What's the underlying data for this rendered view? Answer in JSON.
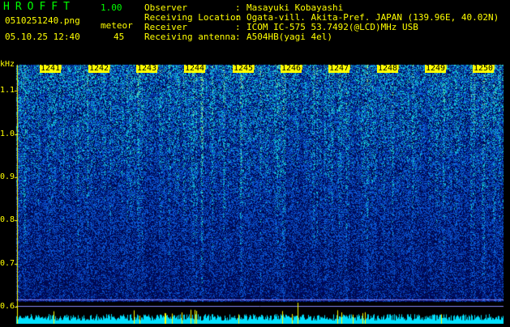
{
  "app": {
    "name": "HROFFT",
    "version": "1.00"
  },
  "capture": {
    "filename": "0510251240.png",
    "datetime": "05.10.25 12:40",
    "meteor_label": "meteor",
    "meteor_count": "45"
  },
  "info": [
    {
      "key": "Observer",
      "sep": ":",
      "value": "Masayuki Kobayashi"
    },
    {
      "key": "Receiving Location",
      "sep": ":",
      "value": "Ogata-vill. Akita-Pref. JAPAN (139.96E, 40.02N)"
    },
    {
      "key": "Receiver",
      "sep": ":",
      "value": "ICOM IC-575 53.7492(@LCD)MHz USB"
    },
    {
      "key": "Receiving antenna",
      "sep": ":",
      "value": "A504HB(yagi 4el)"
    }
  ],
  "spectrogram": {
    "y_unit": "kHz",
    "y_ticks": [
      "1.1",
      "1.0",
      "0.9",
      "0.8",
      "0.7",
      "0.6"
    ],
    "y_tick_values": [
      1.1,
      1.0,
      0.9,
      0.8,
      0.7,
      0.6
    ],
    "y_range": [
      0.58,
      1.16
    ],
    "x_ticks": [
      "1241",
      "1242",
      "1243",
      "1244",
      "1245",
      "1246",
      "1247",
      "1248",
      "1249",
      "1250"
    ],
    "x_tick_values": [
      1241,
      1242,
      1243,
      1244,
      1245,
      1246,
      1247,
      1248,
      1249,
      1250
    ],
    "x_range": [
      1240.1,
      1250.2
    ],
    "colors": {
      "background": "#000000",
      "noise_low": "#0a1a6e",
      "noise_mid": "#1450c8",
      "noise_high": "#28c8c8",
      "peak": "#b4ff78",
      "label": "#ffff00",
      "baseline": "#00e0ff"
    }
  }
}
